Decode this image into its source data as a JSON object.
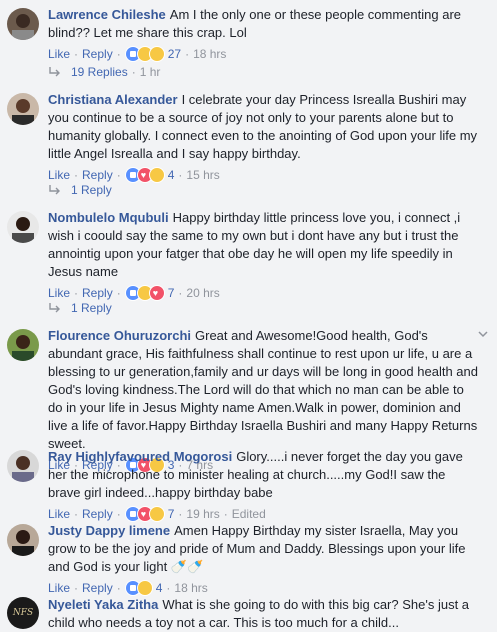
{
  "comments": [
    {
      "name": "Lawrence Chileshe",
      "text": "Am I the only one or these people commenting are blind?? Let me share this crap. Lol",
      "like": "Like",
      "reply": "Reply",
      "count": "27",
      "time": "18 hrs",
      "replies": "19 Replies",
      "replies_time": "1 hr"
    },
    {
      "name": "Christiana Alexander",
      "text": "I celebrate your day Princess Isrealla Bushiri may you continue to be a source of joy not only to your parents alone but to humanity globally. I connect even to the anointing of God upon your life my little Angel Isrealla and I say happy birthday.",
      "like": "Like",
      "reply": "Reply",
      "count": "4",
      "time": "15 hrs",
      "replies": "1 Reply"
    },
    {
      "name": "Nombulelo Mqubuli",
      "text": "Happy birthday little princess love you, i connect ,i wish i coould say the same to my own but i dont have any but i trust the annointig upon your fatger that obe day he will open my life speedily in Jesus name",
      "like": "Like",
      "reply": "Reply",
      "count": "7",
      "time": "20 hrs",
      "replies": "1 Reply"
    },
    {
      "name": "Flourence Ohuruzorchi",
      "text": "Great and Awesome!Good health, God's abundant grace, His faithfulness shall continue to rest upon ur life, u are a blessing to ur generation,family and ur days will be long in good health and God's loving kindness.The Lord will do that which no man can be able to do in your life in Jesus Mighty name Amen.Walk in power, dominion and live a life of favor.Happy Birthday Israella Bushiri and many Happy Returns sweet.",
      "like": "Like",
      "reply": "Reply",
      "count": "3",
      "time": "7 hrs"
    },
    {
      "name": "Ray Highlyfavoured Mogorosi",
      "text": "Glory.....i never forget the day you gave her the microphone to minister healing at church.....my God!I saw the brave girl indeed...happy birthday babe",
      "like": "Like",
      "reply": "Reply",
      "count": "7",
      "time": "19 hrs",
      "edited": "Edited"
    },
    {
      "name": "Justy Dappy limene",
      "text": "Amen Happy Birthday my sister Israella, May you grow to be the joy and pride of Mum and Daddy. Blessings upon your life and God is your light",
      "like": "Like",
      "reply": "Reply",
      "count": "4",
      "time": "18 hrs"
    },
    {
      "name": "Nyeleti Yaka Zitha",
      "text": "What is she going to do with this big car? She's just a child who needs a toy not a car. This is too much for a child...",
      "avatar_text": "NFS"
    }
  ]
}
